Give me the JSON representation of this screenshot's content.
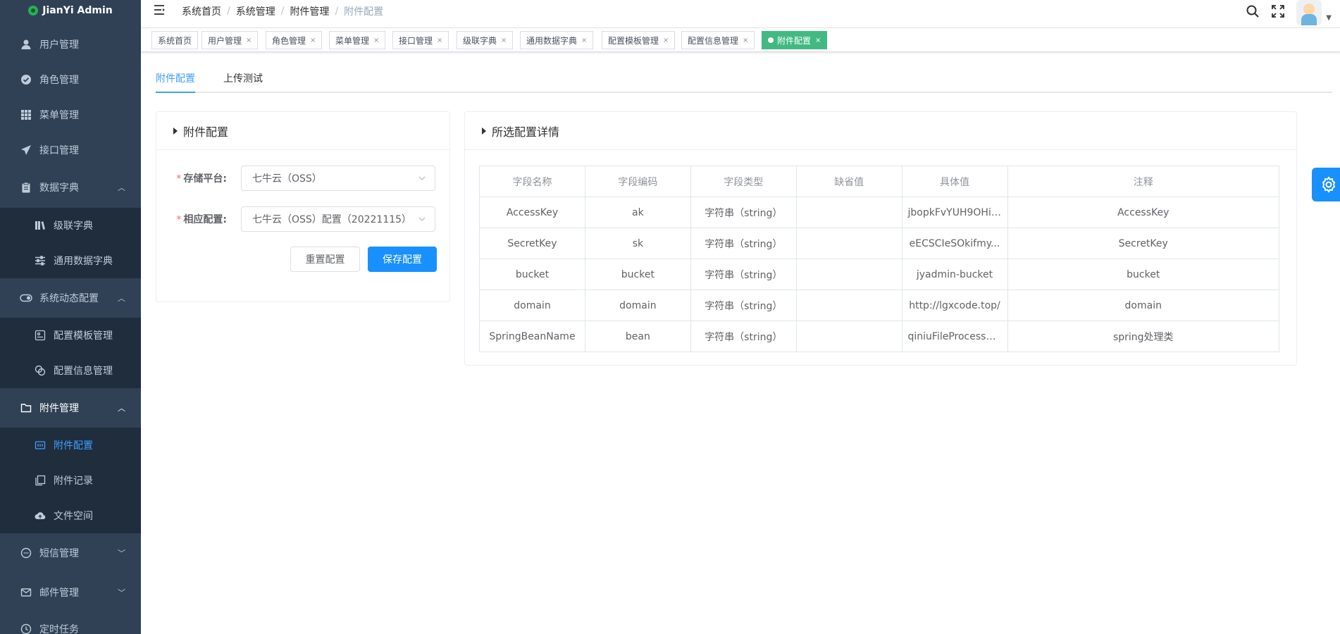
{
  "app": {
    "name": "JianYi Admin"
  },
  "sidebar": {
    "items": [
      {
        "label": "用户管理",
        "icon": "user-icon"
      },
      {
        "label": "角色管理",
        "icon": "check-circle-icon"
      },
      {
        "label": "菜单管理",
        "icon": "grid-icon"
      },
      {
        "label": "接口管理",
        "icon": "send-icon"
      },
      {
        "label": "数据字典",
        "icon": "clipboard-icon"
      },
      {
        "label": "级联字典",
        "icon": "book-icon"
      },
      {
        "label": "通用数据字典",
        "icon": "sliders-icon"
      },
      {
        "label": "系统动态配置",
        "icon": "toggle-icon"
      },
      {
        "label": "配置模板管理",
        "icon": "template-icon"
      },
      {
        "label": "配置信息管理",
        "icon": "link-icon"
      },
      {
        "label": "附件管理",
        "icon": "folder-icon"
      },
      {
        "label": "附件配置",
        "icon": "config-icon"
      },
      {
        "label": "附件记录",
        "icon": "copy-icon"
      },
      {
        "label": "文件空间",
        "icon": "cloud-upload-icon"
      },
      {
        "label": "短信管理",
        "icon": "chat-icon"
      },
      {
        "label": "邮件管理",
        "icon": "mail-icon"
      },
      {
        "label": "定时任务",
        "icon": "clock-icon"
      }
    ]
  },
  "breadcrumb": [
    "系统首页",
    "系统管理",
    "附件管理",
    "附件配置"
  ],
  "tags": [
    "系统首页",
    "用户管理",
    "角色管理",
    "菜单管理",
    "接口管理",
    "级联字典",
    "通用数据字典",
    "配置模板管理",
    "配置信息管理",
    "附件配置"
  ],
  "tabs": [
    "附件配置",
    "上传测试"
  ],
  "left_card": {
    "title": "附件配置",
    "storage_label": "存储平台:",
    "storage_value": "七牛云（OSS）",
    "config_label": "相应配置:",
    "config_value": "七牛云（OSS）配置（20221115）",
    "reset_label": "重置配置",
    "save_label": "保存配置"
  },
  "right_card": {
    "title": "所选配置详情",
    "columns": [
      "字段名称",
      "字段编码",
      "字段类型",
      "缺省值",
      "具体值",
      "注释"
    ],
    "rows": [
      [
        "AccessKey",
        "ak",
        "字符串（string）",
        "",
        "jbopkFvYUH9OHif...",
        "AccessKey"
      ],
      [
        "SecretKey",
        "sk",
        "字符串（string）",
        "",
        "eECSCIeSOkifmy...",
        "SecretKey"
      ],
      [
        "bucket",
        "bucket",
        "字符串（string）",
        "",
        "jyadmin-bucket",
        "bucket"
      ],
      [
        "domain",
        "domain",
        "字符串（string）",
        "",
        "http://lgxcode.top/",
        "domain"
      ],
      [
        "SpringBeanName",
        "bean",
        "字符串（string）",
        "",
        "qiniuFileProcessH...",
        "spring处理类"
      ]
    ]
  },
  "colors": {
    "sidebar_bg": "#304156",
    "accent": "#409eff",
    "primary_button": "#1890ff",
    "active_tag": "#42b983"
  }
}
